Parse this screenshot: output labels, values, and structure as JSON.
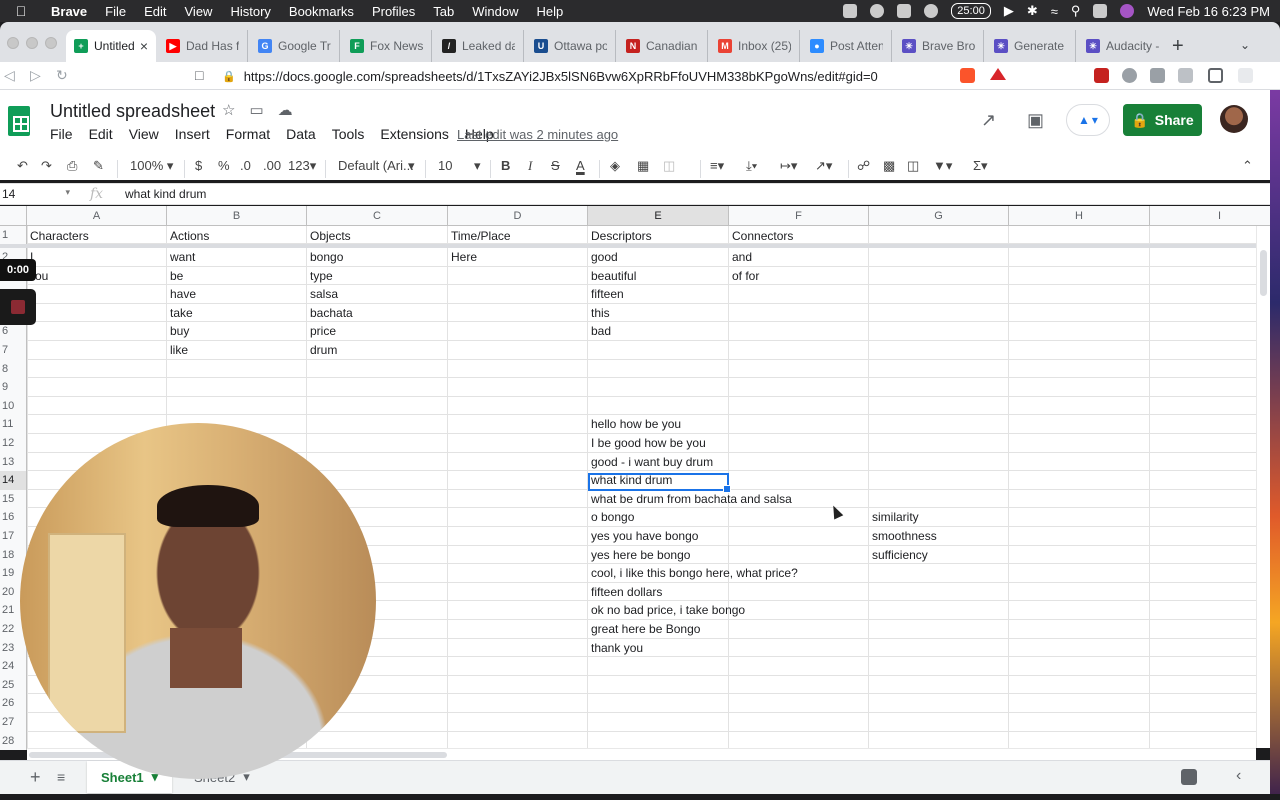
{
  "os_menubar": {
    "app": "Brave",
    "items": [
      "File",
      "Edit",
      "View",
      "History",
      "Bookmarks",
      "Profiles",
      "Tab",
      "Window",
      "Help"
    ],
    "timer": "25:00",
    "clock": "Wed Feb 16  6:23 PM"
  },
  "tabs": [
    {
      "title": "Untitled",
      "color": "#0f9d58",
      "active": true
    },
    {
      "title": "Dad Has fu",
      "color": "#ff0000"
    },
    {
      "title": "Google Tra",
      "color": "#4285f4"
    },
    {
      "title": "Fox News A",
      "color": "#0f9d58"
    },
    {
      "title": "Leaked dat",
      "color": "#222222"
    },
    {
      "title": "Ottawa poli",
      "color": "#1a4d8f"
    },
    {
      "title": "Canadian T",
      "color": "#c5221f"
    },
    {
      "title": "Inbox (25)",
      "color": "#ea4335"
    },
    {
      "title": "Post Attend",
      "color": "#2d8cff"
    },
    {
      "title": "Brave Brow",
      "color": "#5b4fc4"
    },
    {
      "title": "Generate a",
      "color": "#5b4fc4"
    },
    {
      "title": "Audacity -",
      "color": "#5b4fc4"
    }
  ],
  "address": {
    "url": "https://docs.google.com/spreadsheets/d/1TxsZAYi2JBx5lSN6Bvw6XpRRbFfoUVHM338bKPgoWns/edit#gid=0"
  },
  "doc": {
    "title": "Untitled spreadsheet",
    "menu": [
      "File",
      "Edit",
      "View",
      "Insert",
      "Format",
      "Data",
      "Tools",
      "Extensions",
      "Help"
    ],
    "last_edit": "Last edit was 2 minutes ago",
    "share_label": "Share"
  },
  "toolbar": {
    "zoom": "100%",
    "currency": "$",
    "percent": "%",
    "dec_less": ".0",
    "dec_more": ".00",
    "more_formats": "123",
    "font": "Default (Ari...",
    "font_size": "10",
    "bold": "B",
    "italic": "I",
    "text_color": "A"
  },
  "formula": {
    "cell_ref": "14",
    "fx": "fx",
    "value": "what kind drum"
  },
  "columns": [
    "A",
    "B",
    "C",
    "D",
    "E",
    "F",
    "G",
    "H",
    "I"
  ],
  "selected_column": "E",
  "rows": [
    "1",
    "2",
    "3",
    "4",
    "5",
    "6",
    "7",
    "8",
    "9",
    "10",
    "11",
    "12",
    "13",
    "14",
    "15",
    "16",
    "17",
    "18",
    "19",
    "20",
    "21",
    "22",
    "23",
    "24",
    "25",
    "26",
    "27",
    "28"
  ],
  "selected_row": "14",
  "cells": {
    "A1": "Characters",
    "B1": "Actions",
    "C1": "Objects",
    "D1": "Time/Place",
    "E1": "Descriptors",
    "F1": "Connectors",
    "A2": "I",
    "B2": "want",
    "C2": "bongo",
    "D2": "Here",
    "E2": "good",
    "F2": "and",
    "A3": "ou",
    "B3": "be",
    "C3": "type",
    "E3": "beautiful",
    "F3": "of for",
    "B4": "have",
    "C4": "salsa",
    "E4": "fifteen",
    "B5": "take",
    "C5": "bachata",
    "E5": "this",
    "B6": "buy",
    "C6": "price",
    "E6": "bad",
    "B7": "like",
    "C7": "drum",
    "E11": "hello how be you",
    "E12": "I be good how be you",
    "E13": "good - i want buy drum",
    "E14": "what kind drum",
    "E15": "what be drum from bachata and salsa",
    "E16": "o bongo",
    "G16": "similarity",
    "E17": "yes you have bongo",
    "G17": "smoothness",
    "E18": "yes here be bongo",
    "G18": "sufficiency",
    "E19": "cool, i like this bongo here, what price?",
    "E20": "fifteen dollars",
    "E21": "ok no bad price, i take bongo",
    "E22": "great here be Bongo",
    "E23": "thank you"
  },
  "sheets": [
    {
      "name": "Sheet1",
      "active": true
    },
    {
      "name": "Sheet2",
      "active": false
    }
  ],
  "recorder": {
    "time": "0:00"
  }
}
